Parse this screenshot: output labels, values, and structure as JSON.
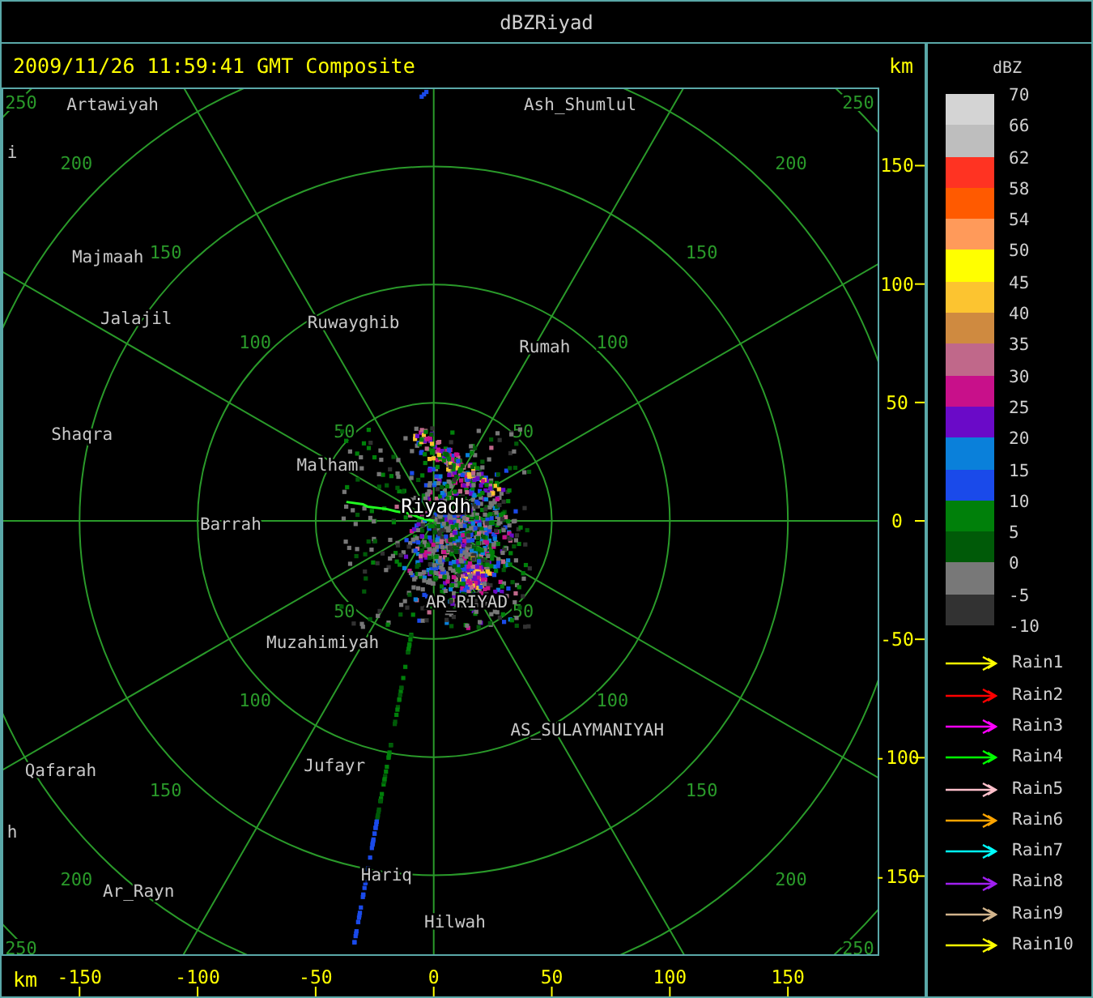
{
  "window": {
    "title": "dBZRiyad"
  },
  "header": {
    "timestamp": "2009/11/26 11:59:41 GMT Composite",
    "unit": "km"
  },
  "plot": {
    "range_rings": [
      {
        "labels": [
          "50",
          "50",
          "50",
          "50"
        ]
      },
      {
        "labels": [
          "100",
          "100",
          "100",
          "100"
        ]
      },
      {
        "labels": [
          "150",
          "150",
          "150",
          "150"
        ]
      },
      {
        "labels": [
          "200",
          "200",
          "200",
          "200"
        ]
      },
      {
        "labels": [
          "250",
          "250",
          "250",
          "250"
        ]
      }
    ],
    "places": [
      {
        "name": "Artawiyah",
        "kind": "town"
      },
      {
        "name": "Ash_Shumlul",
        "kind": "town"
      },
      {
        "name": "i",
        "kind": "town"
      },
      {
        "name": "Majmaah",
        "kind": "town"
      },
      {
        "name": "Jalajil",
        "kind": "town"
      },
      {
        "name": "Ruwayghib",
        "kind": "town"
      },
      {
        "name": "Rumah",
        "kind": "town"
      },
      {
        "name": "Shaqra",
        "kind": "town"
      },
      {
        "name": "Malham",
        "kind": "town"
      },
      {
        "name": "Barrah",
        "kind": "town"
      },
      {
        "name": "Riyadh",
        "kind": "station"
      },
      {
        "name": "AR_RIYAD",
        "kind": "town"
      },
      {
        "name": "Muzahimiyah",
        "kind": "town"
      },
      {
        "name": "AS_SULAYMANIYAH",
        "kind": "town"
      },
      {
        "name": "Qafarah",
        "kind": "town"
      },
      {
        "name": "Jufayr",
        "kind": "town"
      },
      {
        "name": "h",
        "kind": "town"
      },
      {
        "name": "Ar_Rayn",
        "kind": "town"
      },
      {
        "name": "Hariq",
        "kind": "town"
      },
      {
        "name": "Hilwah",
        "kind": "town"
      }
    ],
    "y_axis": {
      "ticks": [
        "150",
        "100",
        "50",
        "0",
        "-50",
        "-100",
        "-150"
      ]
    },
    "x_axis": {
      "unit": "km",
      "ticks": [
        "-150",
        "-100",
        "-50",
        "0",
        "50",
        "100",
        "150"
      ]
    }
  },
  "legend": {
    "title": "dBZ",
    "bins": [
      {
        "color": "#d4d4d4"
      },
      {
        "color": "#bebebe"
      },
      {
        "color": "#ff3322"
      },
      {
        "color": "#ff5a00"
      },
      {
        "color": "#ff9a5a"
      },
      {
        "color": "#ffff00"
      },
      {
        "color": "#fcc430"
      },
      {
        "color": "#cf8a40"
      },
      {
        "color": "#c0688a"
      },
      {
        "color": "#c8108a"
      },
      {
        "color": "#6a0ac8"
      },
      {
        "color": "#0a80da"
      },
      {
        "color": "#1a4aea"
      },
      {
        "color": "#00800a"
      },
      {
        "color": "#005a08"
      },
      {
        "color": "#787878"
      },
      {
        "color": "#323232"
      }
    ],
    "labels": [
      "70",
      "66",
      "62",
      "58",
      "54",
      "50",
      "45",
      "40",
      "35",
      "30",
      "25",
      "20",
      "15",
      "10",
      "5",
      "0",
      "-5",
      "-10"
    ]
  },
  "tracks": [
    {
      "name": "Rain1",
      "color": "#ffff00"
    },
    {
      "name": "Rain2",
      "color": "#ff0000"
    },
    {
      "name": "Rain3",
      "color": "#ff00ff"
    },
    {
      "name": "Rain4",
      "color": "#00ff00"
    },
    {
      "name": "Rain5",
      "color": "#ffc0cb"
    },
    {
      "name": "Rain6",
      "color": "#ffa500"
    },
    {
      "name": "Rain7",
      "color": "#00ffff"
    },
    {
      "name": "Rain8",
      "color": "#a020f0"
    },
    {
      "name": "Rain9",
      "color": "#d2b48c"
    },
    {
      "name": "Rain10",
      "color": "#ffff00"
    }
  ]
}
